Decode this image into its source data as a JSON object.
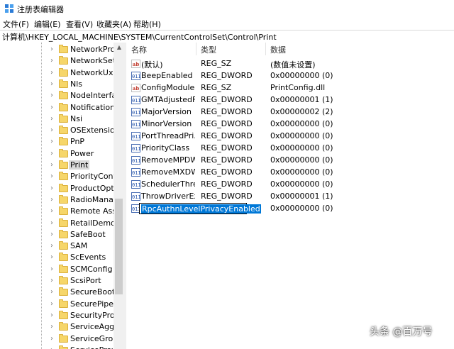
{
  "window": {
    "title": "注册表编辑器"
  },
  "menu": [
    "文件(F)",
    "编辑(E)",
    "查看(V)",
    "收藏夹(A)",
    "帮助(H)"
  ],
  "address": "计算机\\HKEY_LOCAL_MACHINE\\SYSTEM\\CurrentControlSet\\Control\\Print",
  "tree": {
    "items": [
      {
        "label": "NetworkProv",
        "selected": false
      },
      {
        "label": "NetworkSetu",
        "selected": false
      },
      {
        "label": "NetworkUxM",
        "selected": false
      },
      {
        "label": "Nls",
        "selected": false
      },
      {
        "label": "NodeInterfac",
        "selected": false
      },
      {
        "label": "Notifications",
        "selected": false
      },
      {
        "label": "Nsi",
        "selected": false
      },
      {
        "label": "OSExtensionI",
        "selected": false
      },
      {
        "label": "PnP",
        "selected": false
      },
      {
        "label": "Power",
        "selected": false
      },
      {
        "label": "Print",
        "selected": true
      },
      {
        "label": "PriorityContro",
        "selected": false
      },
      {
        "label": "ProductOptic",
        "selected": false
      },
      {
        "label": "RadioManag",
        "selected": false
      },
      {
        "label": "Remote Assis",
        "selected": false
      },
      {
        "label": "RetailDemo",
        "selected": false
      },
      {
        "label": "SafeBoot",
        "selected": false
      },
      {
        "label": "SAM",
        "selected": false
      },
      {
        "label": "ScEvents",
        "selected": false
      },
      {
        "label": "SCMConfig",
        "selected": false
      },
      {
        "label": "ScsiPort",
        "selected": false
      },
      {
        "label": "SecureBoot",
        "selected": false
      },
      {
        "label": "SecurePipeSe",
        "selected": false
      },
      {
        "label": "SecurityProvi",
        "selected": false
      },
      {
        "label": "ServiceAggre",
        "selected": false
      },
      {
        "label": "ServiceGroup",
        "selected": false
      },
      {
        "label": "ServiceProvid",
        "selected": false
      }
    ]
  },
  "list": {
    "headers": {
      "name": "名称",
      "type": "类型",
      "data": "数据"
    },
    "rows": [
      {
        "icon": "string-value-icon",
        "name": "(默认)",
        "type": "REG_SZ",
        "data": "(数值未设置)"
      },
      {
        "icon": "binary-value-icon",
        "name": "BeepEnabled",
        "type": "REG_DWORD",
        "data": "0x00000000 (0)"
      },
      {
        "icon": "string-value-icon",
        "name": "ConfigModule",
        "type": "REG_SZ",
        "data": "PrintConfig.dll"
      },
      {
        "icon": "binary-value-icon",
        "name": "GMTAdjustedF...",
        "type": "REG_DWORD",
        "data": "0x00000001 (1)"
      },
      {
        "icon": "binary-value-icon",
        "name": "MajorVersion",
        "type": "REG_DWORD",
        "data": "0x00000002 (2)"
      },
      {
        "icon": "binary-value-icon",
        "name": "MinorVersion",
        "type": "REG_DWORD",
        "data": "0x00000000 (0)"
      },
      {
        "icon": "binary-value-icon",
        "name": "PortThreadPri...",
        "type": "REG_DWORD",
        "data": "0x00000000 (0)"
      },
      {
        "icon": "binary-value-icon",
        "name": "PriorityClass",
        "type": "REG_DWORD",
        "data": "0x00000000 (0)"
      },
      {
        "icon": "binary-value-icon",
        "name": "RemoveMPDW",
        "type": "REG_DWORD",
        "data": "0x00000000 (0)"
      },
      {
        "icon": "binary-value-icon",
        "name": "RemoveMXDW",
        "type": "REG_DWORD",
        "data": "0x00000000 (0)"
      },
      {
        "icon": "binary-value-icon",
        "name": "SchedulerThre...",
        "type": "REG_DWORD",
        "data": "0x00000000 (0)"
      },
      {
        "icon": "binary-value-icon",
        "name": "ThrowDriverEx...",
        "type": "REG_DWORD",
        "data": "0x00000001 (1)"
      }
    ],
    "editing_row": {
      "icon": "binary-value-icon",
      "name": "RpcAuthnLevelPrivacyEnabled",
      "type": "",
      "data": "0x00000000 (0)"
    }
  },
  "watermark": "头条 @百万号",
  "colors": {
    "selection": "#0078d7",
    "folder": "#f6d66a"
  }
}
